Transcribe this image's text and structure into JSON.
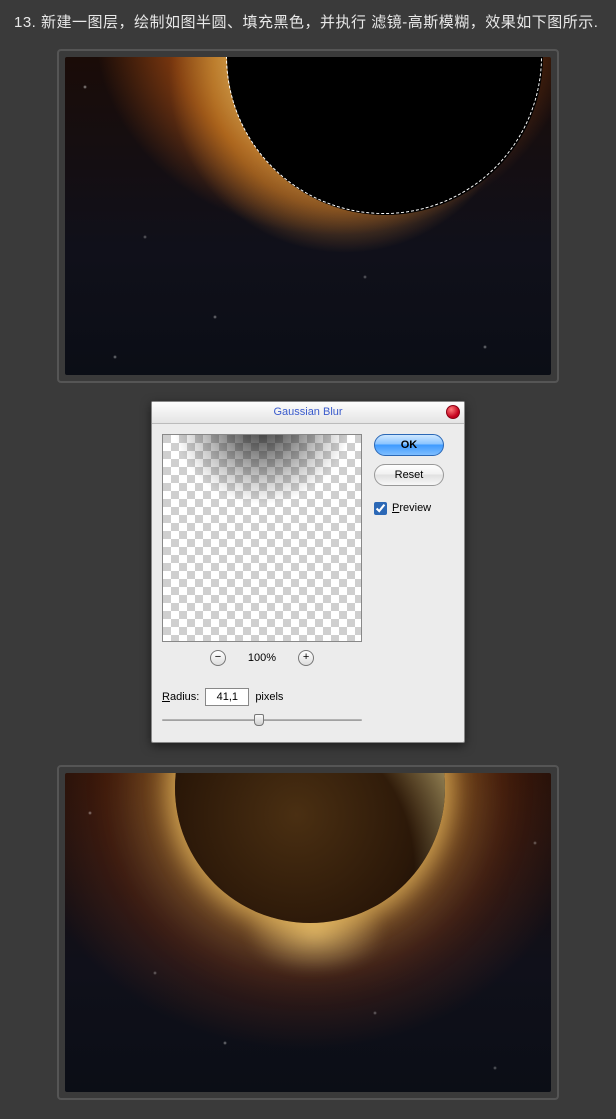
{
  "instruction": {
    "step": "13.",
    "text": "新建一图层，绘制如图半圆、填充黑色，并执行 滤镜-高斯模糊，效果如下图所示."
  },
  "dialog": {
    "title": "Gaussian Blur",
    "ok": "OK",
    "reset": "Reset",
    "preview_prefix": "P",
    "preview_rest": "review",
    "zoom": "100%",
    "radius_prefix": "R",
    "radius_rest": "adius:",
    "radius_value": "41,1",
    "radius_unit": "pixels"
  },
  "chart_data": null
}
